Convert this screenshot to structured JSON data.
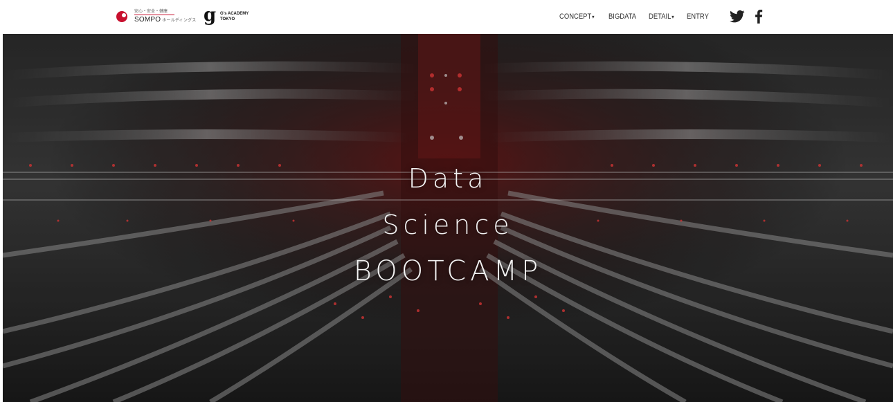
{
  "header": {
    "sompo_logo": {
      "tagline": "安心・安全・健康",
      "name": "SOMPO",
      "sub": "ホールディングス"
    },
    "gs_logo": {
      "mark": "g",
      "line1": "G's ACADEMY",
      "line2": "TOKYO"
    },
    "nav": [
      {
        "label": "CONCEPT",
        "dropdown": true
      },
      {
        "label": "BIGDATA",
        "dropdown": false
      },
      {
        "label": "DETAIL",
        "dropdown": true
      },
      {
        "label": "ENTRY",
        "dropdown": false
      }
    ],
    "caret": "▾",
    "social": {
      "twitter_icon": "twitter-icon",
      "facebook_icon": "facebook-icon"
    }
  },
  "hero": {
    "line1": "Data",
    "line2": "Science",
    "line3": "BOOTCAMP"
  },
  "colors": {
    "brand_red": "#c8102e",
    "nav_text": "#333333",
    "hero_text": "#f2f2f2"
  }
}
